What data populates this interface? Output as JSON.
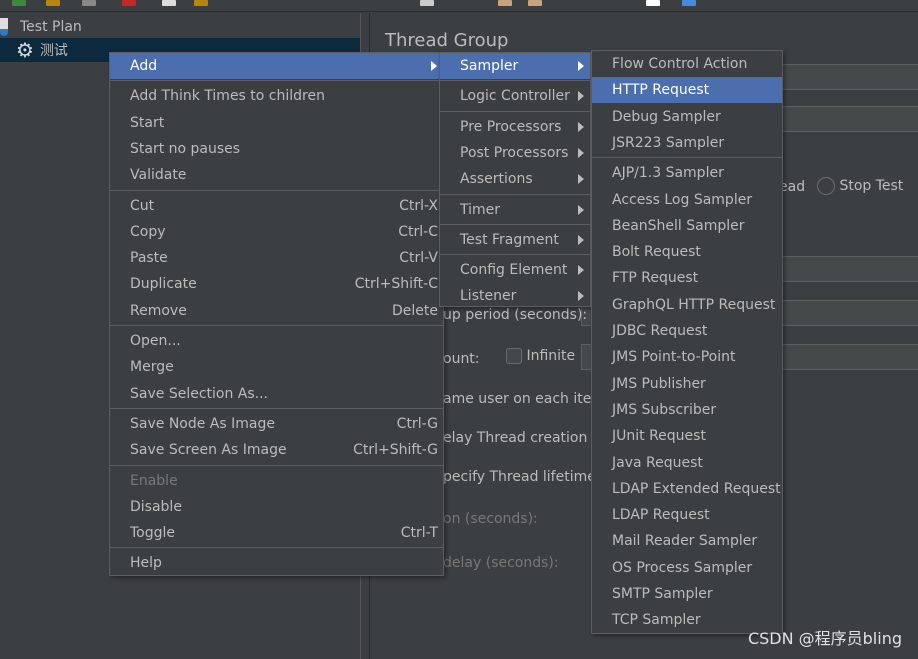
{
  "tree": {
    "items": [
      {
        "label": "Test Plan",
        "icon": "flask-icon"
      },
      {
        "label": "测试",
        "icon": "gear-icon",
        "selected": true
      }
    ]
  },
  "panel": {
    "title": "Thread Group",
    "texts": {
      "ramp_up": "up period (seconds):",
      "loop_count": "ount:",
      "infinite": "Infinite",
      "same_user": "ame user on each itera",
      "delay": "elay Thread creation u",
      "lifetime": "pecify Thread lifetime",
      "duration": "on (seconds):",
      "startup_delay": "delay (seconds):",
      "thread_fragment": "ead",
      "stop_test": "Stop Test"
    }
  },
  "context_menu": {
    "items": [
      {
        "label": "Add",
        "submenu": true,
        "highlighted": true
      },
      {
        "sep": true
      },
      {
        "label": "Add Think Times to children"
      },
      {
        "label": "Start"
      },
      {
        "label": "Start no pauses"
      },
      {
        "label": "Validate"
      },
      {
        "sep": true
      },
      {
        "label": "Cut",
        "shortcut": "Ctrl-X"
      },
      {
        "label": "Copy",
        "shortcut": "Ctrl-C"
      },
      {
        "label": "Paste",
        "shortcut": "Ctrl-V"
      },
      {
        "label": "Duplicate",
        "shortcut": "Ctrl+Shift-C"
      },
      {
        "label": "Remove",
        "shortcut": "Delete"
      },
      {
        "sep": true
      },
      {
        "label": "Open..."
      },
      {
        "label": "Merge"
      },
      {
        "label": "Save Selection As..."
      },
      {
        "sep": true
      },
      {
        "label": "Save Node As Image",
        "shortcut": "Ctrl-G"
      },
      {
        "label": "Save Screen As Image",
        "shortcut": "Ctrl+Shift-G"
      },
      {
        "sep": true
      },
      {
        "label": "Enable",
        "disabled": true
      },
      {
        "label": "Disable"
      },
      {
        "label": "Toggle",
        "shortcut": "Ctrl-T"
      },
      {
        "sep": true
      },
      {
        "label": "Help"
      }
    ]
  },
  "add_submenu": {
    "items": [
      {
        "label": "Sampler",
        "submenu": true,
        "highlighted": true
      },
      {
        "sep": true
      },
      {
        "label": "Logic Controller",
        "submenu": true
      },
      {
        "sep": true
      },
      {
        "label": "Pre Processors",
        "submenu": true
      },
      {
        "label": "Post Processors",
        "submenu": true
      },
      {
        "label": "Assertions",
        "submenu": true
      },
      {
        "sep": true
      },
      {
        "label": "Timer",
        "submenu": true
      },
      {
        "sep": true
      },
      {
        "label": "Test Fragment",
        "submenu": true
      },
      {
        "sep": true
      },
      {
        "label": "Config Element",
        "submenu": true
      },
      {
        "label": "Listener",
        "submenu": true
      }
    ]
  },
  "sampler_submenu": {
    "items": [
      {
        "label": "Flow Control Action"
      },
      {
        "label": "HTTP Request",
        "highlighted": true
      },
      {
        "label": "Debug Sampler"
      },
      {
        "label": "JSR223 Sampler"
      },
      {
        "sep": true
      },
      {
        "label": "AJP/1.3 Sampler"
      },
      {
        "label": "Access Log Sampler"
      },
      {
        "label": "BeanShell Sampler"
      },
      {
        "label": "Bolt Request"
      },
      {
        "label": "FTP Request"
      },
      {
        "label": "GraphQL HTTP Request"
      },
      {
        "label": "JDBC Request"
      },
      {
        "label": "JMS Point-to-Point"
      },
      {
        "label": "JMS Publisher"
      },
      {
        "label": "JMS Subscriber"
      },
      {
        "label": "JUnit Request"
      },
      {
        "label": "Java Request"
      },
      {
        "label": "LDAP Extended Request"
      },
      {
        "label": "LDAP Request"
      },
      {
        "label": "Mail Reader Sampler"
      },
      {
        "label": "OS Process Sampler"
      },
      {
        "label": "SMTP Sampler"
      },
      {
        "label": "TCP Sampler"
      }
    ]
  },
  "watermark": "CSDN @程序员bling",
  "colors": {
    "background": "#3c3f41",
    "highlight": "#4b6eaf",
    "tree_selection": "#0d293e"
  }
}
